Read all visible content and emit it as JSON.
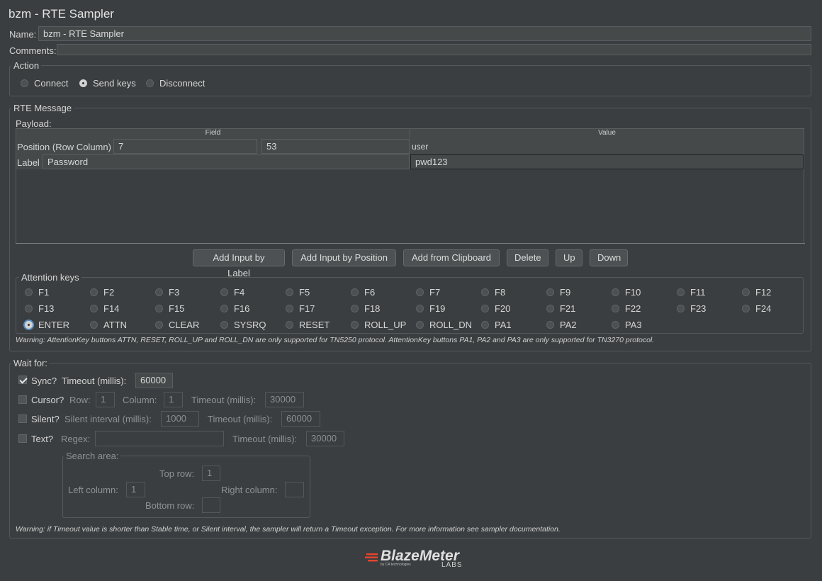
{
  "window": {
    "title": "bzm - RTE Sampler"
  },
  "name": {
    "label": "Name:",
    "value": "bzm - RTE Sampler"
  },
  "comments": {
    "label": "Comments:"
  },
  "action": {
    "title": "Action",
    "options": [
      "Connect",
      "Send keys",
      "Disconnect"
    ],
    "selected": "Send keys"
  },
  "rte_message": {
    "title": "RTE Message",
    "payload_label": "Payload:",
    "columns": [
      "Field",
      "Value"
    ],
    "rows": [
      {
        "field_label": "Position (Row Column)",
        "row": "7",
        "column": "53",
        "value": "user"
      },
      {
        "field_label": "Label",
        "label_value": "Password",
        "value": "pwd123"
      }
    ],
    "buttons": [
      "Add Input by Label",
      "Add Input by Position",
      "Add from Clipboard",
      "Delete",
      "Up",
      "Down"
    ]
  },
  "attention_keys": {
    "title": "Attention keys",
    "keys": [
      "F1",
      "F2",
      "F3",
      "F4",
      "F5",
      "F6",
      "F7",
      "F8",
      "F9",
      "F10",
      "F11",
      "F12",
      "F13",
      "F14",
      "F15",
      "F16",
      "F17",
      "F18",
      "F19",
      "F20",
      "F21",
      "F22",
      "F23",
      "F24",
      "ENTER",
      "ATTN",
      "CLEAR",
      "SYSRQ",
      "RESET",
      "ROLL_UP",
      "ROLL_DN",
      "PA1",
      "PA2",
      "PA3"
    ],
    "selected": "ENTER",
    "warning": "Warning: AttentionKey buttons ATTN, RESET, ROLL_UP and ROLL_DN are only supported for TN5250 protocol. AttentionKey buttons PA1, PA2 and PA3 are only supported for TN3270 protocol."
  },
  "wait_for": {
    "title": "Wait for:",
    "sync": {
      "label": "Sync?",
      "checked": true,
      "timeout_label": "Timeout (millis):",
      "timeout": "60000"
    },
    "cursor": {
      "label": "Cursor?",
      "checked": false,
      "row_label": "Row:",
      "row": "1",
      "column_label": "Column:",
      "column": "1",
      "timeout_label": "Timeout (millis):",
      "timeout": "30000"
    },
    "silent": {
      "label": "Silent?",
      "checked": false,
      "interval_label": "Silent interval (millis):",
      "interval": "1000",
      "timeout_label": "Timeout (millis):",
      "timeout": "60000"
    },
    "text": {
      "label": "Text?",
      "checked": false,
      "regex_label": "Regex:",
      "regex": "",
      "timeout_label": "Timeout (millis):",
      "timeout": "30000"
    },
    "search_area": {
      "title": "Search area:",
      "top_row_label": "Top row:",
      "top_row": "1",
      "left_column_label": "Left column:",
      "left_column": "1",
      "right_column_label": "Right column:",
      "right_column": "",
      "bottom_row_label": "Bottom row:",
      "bottom_row": ""
    },
    "warning": "Warning: if Timeout value is shorter than Stable time, or Silent interval, the sampler will return a Timeout exception. For more information see sampler documentation."
  },
  "logo": {
    "brand": "BlazeMeter",
    "byline": "by CA technologies",
    "sub": "LABS",
    "accent": "#e8442d"
  },
  "colors": {
    "background": "#3b3e40",
    "field": "#45494a",
    "border": "#56595b"
  }
}
